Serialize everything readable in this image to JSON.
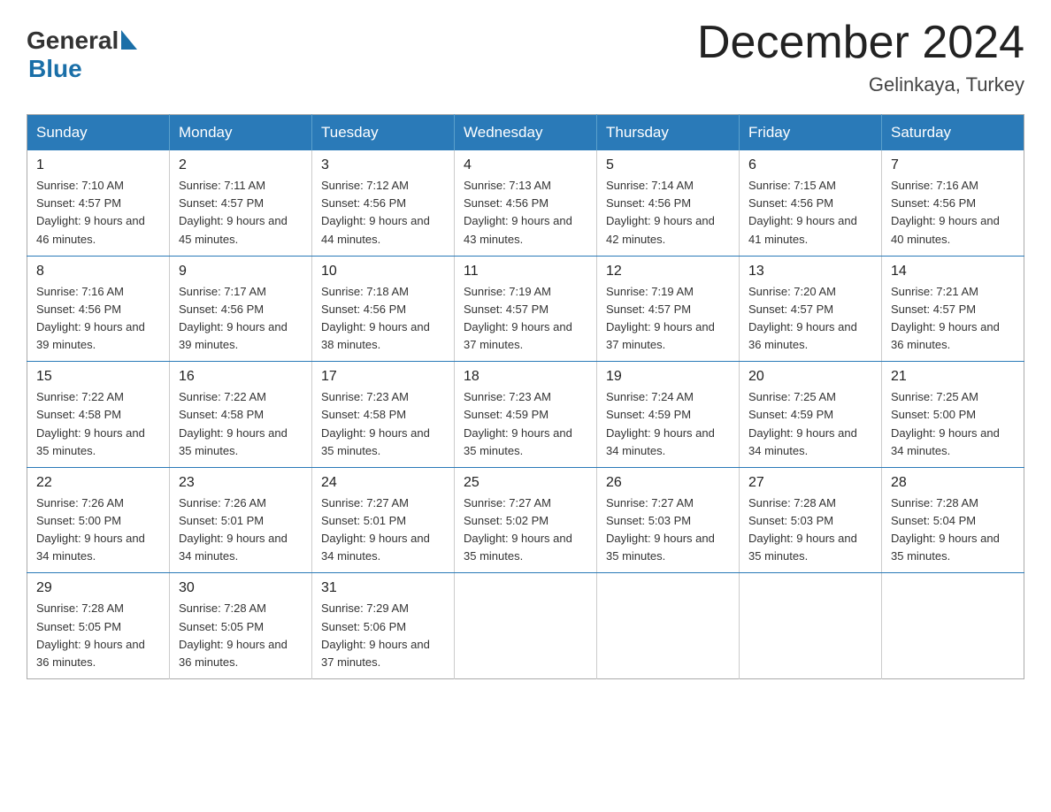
{
  "logo": {
    "general": "General",
    "arrow": "▶",
    "blue": "Blue"
  },
  "title": {
    "month_year": "December 2024",
    "location": "Gelinkaya, Turkey"
  },
  "headers": [
    "Sunday",
    "Monday",
    "Tuesday",
    "Wednesday",
    "Thursday",
    "Friday",
    "Saturday"
  ],
  "weeks": [
    [
      {
        "day": "1",
        "sunrise": "7:10 AM",
        "sunset": "4:57 PM",
        "daylight": "9 hours and 46 minutes."
      },
      {
        "day": "2",
        "sunrise": "7:11 AM",
        "sunset": "4:57 PM",
        "daylight": "9 hours and 45 minutes."
      },
      {
        "day": "3",
        "sunrise": "7:12 AM",
        "sunset": "4:56 PM",
        "daylight": "9 hours and 44 minutes."
      },
      {
        "day": "4",
        "sunrise": "7:13 AM",
        "sunset": "4:56 PM",
        "daylight": "9 hours and 43 minutes."
      },
      {
        "day": "5",
        "sunrise": "7:14 AM",
        "sunset": "4:56 PM",
        "daylight": "9 hours and 42 minutes."
      },
      {
        "day": "6",
        "sunrise": "7:15 AM",
        "sunset": "4:56 PM",
        "daylight": "9 hours and 41 minutes."
      },
      {
        "day": "7",
        "sunrise": "7:16 AM",
        "sunset": "4:56 PM",
        "daylight": "9 hours and 40 minutes."
      }
    ],
    [
      {
        "day": "8",
        "sunrise": "7:16 AM",
        "sunset": "4:56 PM",
        "daylight": "9 hours and 39 minutes."
      },
      {
        "day": "9",
        "sunrise": "7:17 AM",
        "sunset": "4:56 PM",
        "daylight": "9 hours and 39 minutes."
      },
      {
        "day": "10",
        "sunrise": "7:18 AM",
        "sunset": "4:56 PM",
        "daylight": "9 hours and 38 minutes."
      },
      {
        "day": "11",
        "sunrise": "7:19 AM",
        "sunset": "4:57 PM",
        "daylight": "9 hours and 37 minutes."
      },
      {
        "day": "12",
        "sunrise": "7:19 AM",
        "sunset": "4:57 PM",
        "daylight": "9 hours and 37 minutes."
      },
      {
        "day": "13",
        "sunrise": "7:20 AM",
        "sunset": "4:57 PM",
        "daylight": "9 hours and 36 minutes."
      },
      {
        "day": "14",
        "sunrise": "7:21 AM",
        "sunset": "4:57 PM",
        "daylight": "9 hours and 36 minutes."
      }
    ],
    [
      {
        "day": "15",
        "sunrise": "7:22 AM",
        "sunset": "4:58 PM",
        "daylight": "9 hours and 35 minutes."
      },
      {
        "day": "16",
        "sunrise": "7:22 AM",
        "sunset": "4:58 PM",
        "daylight": "9 hours and 35 minutes."
      },
      {
        "day": "17",
        "sunrise": "7:23 AM",
        "sunset": "4:58 PM",
        "daylight": "9 hours and 35 minutes."
      },
      {
        "day": "18",
        "sunrise": "7:23 AM",
        "sunset": "4:59 PM",
        "daylight": "9 hours and 35 minutes."
      },
      {
        "day": "19",
        "sunrise": "7:24 AM",
        "sunset": "4:59 PM",
        "daylight": "9 hours and 34 minutes."
      },
      {
        "day": "20",
        "sunrise": "7:25 AM",
        "sunset": "4:59 PM",
        "daylight": "9 hours and 34 minutes."
      },
      {
        "day": "21",
        "sunrise": "7:25 AM",
        "sunset": "5:00 PM",
        "daylight": "9 hours and 34 minutes."
      }
    ],
    [
      {
        "day": "22",
        "sunrise": "7:26 AM",
        "sunset": "5:00 PM",
        "daylight": "9 hours and 34 minutes."
      },
      {
        "day": "23",
        "sunrise": "7:26 AM",
        "sunset": "5:01 PM",
        "daylight": "9 hours and 34 minutes."
      },
      {
        "day": "24",
        "sunrise": "7:27 AM",
        "sunset": "5:01 PM",
        "daylight": "9 hours and 34 minutes."
      },
      {
        "day": "25",
        "sunrise": "7:27 AM",
        "sunset": "5:02 PM",
        "daylight": "9 hours and 35 minutes."
      },
      {
        "day": "26",
        "sunrise": "7:27 AM",
        "sunset": "5:03 PM",
        "daylight": "9 hours and 35 minutes."
      },
      {
        "day": "27",
        "sunrise": "7:28 AM",
        "sunset": "5:03 PM",
        "daylight": "9 hours and 35 minutes."
      },
      {
        "day": "28",
        "sunrise": "7:28 AM",
        "sunset": "5:04 PM",
        "daylight": "9 hours and 35 minutes."
      }
    ],
    [
      {
        "day": "29",
        "sunrise": "7:28 AM",
        "sunset": "5:05 PM",
        "daylight": "9 hours and 36 minutes."
      },
      {
        "day": "30",
        "sunrise": "7:28 AM",
        "sunset": "5:05 PM",
        "daylight": "9 hours and 36 minutes."
      },
      {
        "day": "31",
        "sunrise": "7:29 AM",
        "sunset": "5:06 PM",
        "daylight": "9 hours and 37 minutes."
      },
      null,
      null,
      null,
      null
    ]
  ]
}
